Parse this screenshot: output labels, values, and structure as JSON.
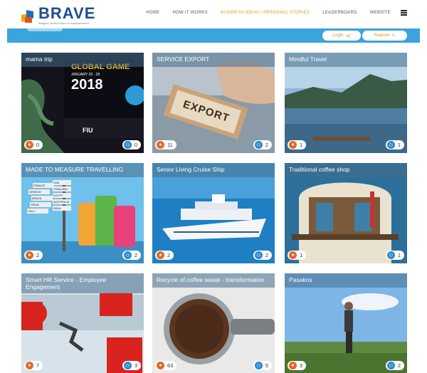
{
  "brand": {
    "name": "BRAVE",
    "tagline": "Bridging Youth's Voice to Empowerment"
  },
  "nav": [
    "HOME",
    "HOW IT WORKS",
    "BUSINESS IDEAS / PERSONAL STORIES",
    "LEADERBOARD",
    "WEBSITE"
  ],
  "auth": {
    "login": "Login",
    "register": "Register"
  },
  "cards": [
    {
      "title": "mama trip",
      "comments": "0",
      "people": "0",
      "poster": {
        "line1": "GLOBAL GAME",
        "dates": "JANUARY 26 - 28",
        "year": "2018",
        "org": "FIU"
      }
    },
    {
      "title": "SERVICE EXPORT",
      "comments": "11",
      "people": "2",
      "stamp": "EXPORT"
    },
    {
      "title": "Mindful Travel",
      "comments": "1",
      "people": "1"
    },
    {
      "title": "MADE TO MEASURE TRAVELLING",
      "comments": "2",
      "people": "2",
      "signs": [
        "FRANCE",
        "GREECE",
        "BRAZIL",
        "SPAIN",
        "ITALY",
        "USA",
        "THAILAND",
        "EGYPT",
        "AUSTRALIA",
        "INDIA"
      ]
    },
    {
      "title": "Senior Living Cruise Ship",
      "comments": "2",
      "people": "2"
    },
    {
      "title": "Traditional coffee shop",
      "comments": "1",
      "people": "1"
    },
    {
      "title": "Smart HR Service - Employee Engagement",
      "comments": "7",
      "people": "3"
    },
    {
      "title": "Recycle of coffee waste - transformation",
      "comments": "63",
      "people": "5"
    },
    {
      "title": "Pasakos",
      "comments": "3",
      "people": "2"
    }
  ]
}
